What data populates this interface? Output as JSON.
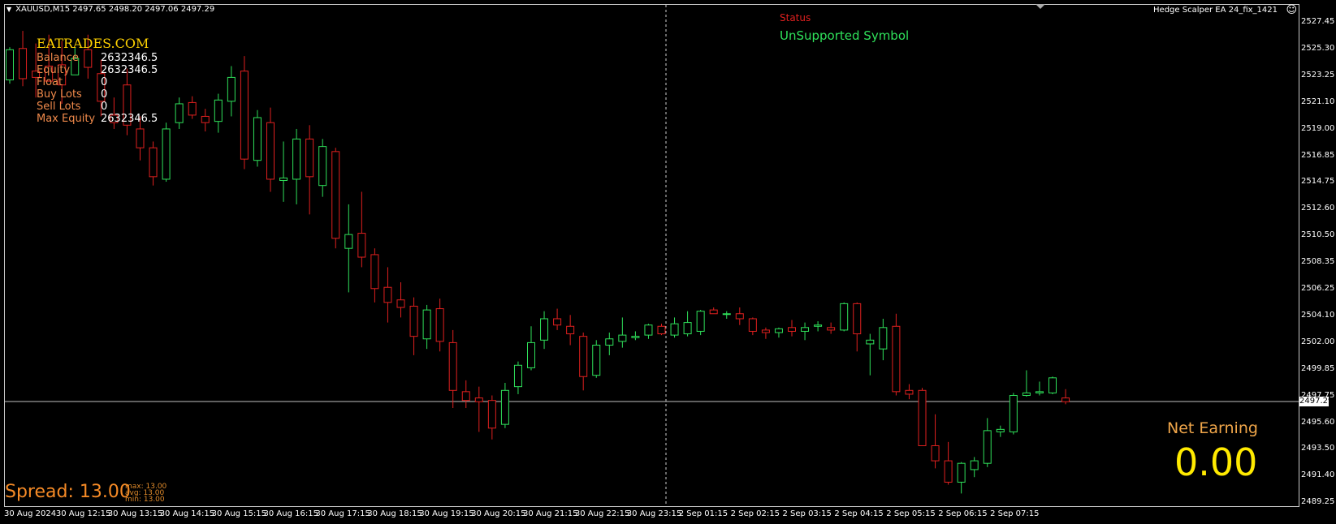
{
  "header": {
    "symbol_line": "XAUUSD,M15  2497.65 2498.20 2497.06 2497.29",
    "ea_name": "Hedge Scalper EA 24_fix_1421",
    "ea_face": "☺"
  },
  "info_panel": {
    "brand": "EATRADES.COM",
    "rows": [
      {
        "label": "Balance",
        "value": "2632346.5"
      },
      {
        "label": "Equity",
        "value": "2632346.5"
      },
      {
        "label": "Float",
        "value": "0"
      },
      {
        "label": "Buy Lots",
        "value": "0"
      },
      {
        "label": "Sell Lots",
        "value": "0"
      },
      {
        "label": "Max Equity",
        "value": "2632346.5"
      }
    ]
  },
  "status": {
    "label": "Status",
    "value": "UnSupported Symbol"
  },
  "net_earning": {
    "label": "Net Earning",
    "value": "0.00"
  },
  "spread": {
    "text": "Spread: 13.00",
    "max": "max: 13.00",
    "avg": "avg: 13.00",
    "min": "min: 13.00"
  },
  "current_price": "2497.29",
  "colors": {
    "bull": "#2fe05a",
    "bear": "#e0201f",
    "background": "#000000"
  },
  "chart_data": {
    "type": "candlestick",
    "y_ticks": [
      "2527.45",
      "2525.30",
      "2523.25",
      "2521.10",
      "2519.00",
      "2516.85",
      "2514.75",
      "2512.60",
      "2510.50",
      "2508.35",
      "2506.25",
      "2504.10",
      "2502.00",
      "2499.85",
      "2497.75",
      "2495.60",
      "2493.50",
      "2491.40",
      "2489.25"
    ],
    "x_ticks": [
      "30 Aug 2024",
      "30 Aug 12:15",
      "30 Aug 13:15",
      "30 Aug 14:15",
      "30 Aug 15:15",
      "30 Aug 16:15",
      "30 Aug 17:15",
      "30 Aug 18:15",
      "30 Aug 19:15",
      "30 Aug 20:15",
      "30 Aug 21:15",
      "30 Aug 22:15",
      "30 Aug 23:15",
      "2 Sep 01:15",
      "2 Sep 02:15",
      "2 Sep 03:15",
      "2 Sep 04:15",
      "2 Sep 05:15",
      "2 Sep 06:15",
      "2 Sep 07:15"
    ],
    "ohlc": [
      [
        2522.9,
        2525.5,
        2522.6,
        2525.3
      ],
      [
        2525.4,
        2526.8,
        2522.4,
        2523.0
      ],
      [
        2523.6,
        2525.8,
        2521.5,
        2523.1
      ],
      [
        2524.0,
        2526.5,
        2523.0,
        2522.8
      ],
      [
        2524.1,
        2526.0,
        2521.0,
        2522.5
      ],
      [
        2523.3,
        2525.5,
        2524.0,
        2524.6
      ],
      [
        2525.3,
        2526.5,
        2523.0,
        2523.9
      ],
      [
        2523.4,
        2524.5,
        2520.0,
        2521.2
      ],
      [
        2520.1,
        2521.5,
        2519.0,
        2519.5
      ],
      [
        2522.5,
        2523.8,
        2518.5,
        2519.3
      ],
      [
        2519.0,
        2520.0,
        2516.5,
        2517.5
      ],
      [
        2517.5,
        2518.0,
        2514.5,
        2515.2
      ],
      [
        2515.0,
        2519.5,
        2514.8,
        2519.0
      ],
      [
        2519.5,
        2521.5,
        2519.0,
        2521.0
      ],
      [
        2521.1,
        2521.6,
        2519.8,
        2520.1
      ],
      [
        2520.0,
        2520.6,
        2518.8,
        2519.5
      ],
      [
        2519.6,
        2521.8,
        2518.7,
        2521.3
      ],
      [
        2521.2,
        2524.0,
        2520.0,
        2523.1
      ],
      [
        2523.6,
        2524.8,
        2515.8,
        2516.6
      ],
      [
        2516.5,
        2520.5,
        2516.0,
        2519.9
      ],
      [
        2519.5,
        2520.7,
        2514.0,
        2515.0
      ],
      [
        2514.9,
        2518.0,
        2513.2,
        2515.1
      ],
      [
        2515.0,
        2519.0,
        2513.0,
        2518.2
      ],
      [
        2518.2,
        2519.3,
        2512.2,
        2515.2
      ],
      [
        2514.5,
        2518.2,
        2513.6,
        2517.6
      ],
      [
        2517.2,
        2517.5,
        2509.5,
        2510.3
      ],
      [
        2509.5,
        2513.0,
        2506.0,
        2510.6
      ],
      [
        2510.7,
        2514.0,
        2508.0,
        2508.8
      ],
      [
        2509.0,
        2509.5,
        2505.2,
        2506.3
      ],
      [
        2506.4,
        2508.0,
        2503.6,
        2505.2
      ],
      [
        2505.4,
        2506.8,
        2504.0,
        2504.8
      ],
      [
        2504.9,
        2505.6,
        2501.0,
        2502.5
      ],
      [
        2502.3,
        2505.0,
        2501.5,
        2504.6
      ],
      [
        2504.7,
        2505.5,
        2501.3,
        2502.1
      ],
      [
        2502.0,
        2503.0,
        2496.8,
        2498.2
      ],
      [
        2498.1,
        2499.0,
        2496.8,
        2497.4
      ],
      [
        2497.6,
        2498.5,
        2494.9,
        2497.3
      ],
      [
        2497.4,
        2497.8,
        2494.3,
        2495.2
      ],
      [
        2495.5,
        2498.8,
        2495.2,
        2498.2
      ],
      [
        2498.5,
        2500.5,
        2497.9,
        2500.2
      ],
      [
        2500.0,
        2503.3,
        2499.8,
        2502.0
      ],
      [
        2502.2,
        2504.5,
        2501.5,
        2503.9
      ],
      [
        2503.9,
        2504.7,
        2503.0,
        2503.4
      ],
      [
        2503.3,
        2504.2,
        2501.8,
        2502.7
      ],
      [
        2502.5,
        2502.8,
        2498.2,
        2499.3
      ],
      [
        2499.4,
        2502.2,
        2499.2,
        2501.8
      ],
      [
        2501.8,
        2502.8,
        2501.0,
        2502.3
      ],
      [
        2502.1,
        2504.0,
        2501.6,
        2502.6
      ],
      [
        2502.4,
        2502.9,
        2502.2,
        2502.5
      ],
      [
        2502.6,
        2503.5,
        2502.3,
        2503.4
      ],
      [
        2503.3,
        2503.5,
        2502.6,
        2502.7
      ],
      [
        2502.6,
        2504.0,
        2502.4,
        2503.5
      ],
      [
        2502.7,
        2504.5,
        2502.5,
        2503.6
      ],
      [
        2502.9,
        2504.6,
        2502.6,
        2504.5
      ],
      [
        2504.6,
        2504.8,
        2504.3,
        2504.3
      ],
      [
        2504.3,
        2504.5,
        2503.9,
        2504.3
      ],
      [
        2504.3,
        2504.8,
        2503.4,
        2503.9
      ],
      [
        2503.9,
        2504.0,
        2502.6,
        2502.9
      ],
      [
        2503.0,
        2503.2,
        2502.3,
        2502.8
      ],
      [
        2502.8,
        2503.2,
        2502.4,
        2503.1
      ],
      [
        2503.2,
        2503.8,
        2502.5,
        2502.9
      ],
      [
        2502.9,
        2503.6,
        2502.2,
        2503.2
      ],
      [
        2503.3,
        2503.7,
        2502.9,
        2503.4
      ],
      [
        2503.2,
        2503.6,
        2502.7,
        2503.0
      ],
      [
        2503.0,
        2505.2,
        2502.9,
        2505.1
      ],
      [
        2505.1,
        2505.2,
        2501.3,
        2502.7
      ],
      [
        2501.9,
        2502.7,
        2499.4,
        2502.2
      ],
      [
        2501.5,
        2503.9,
        2500.6,
        2503.2
      ],
      [
        2503.3,
        2504.3,
        2497.8,
        2498.1
      ],
      [
        2498.2,
        2498.7,
        2497.5,
        2497.9
      ],
      [
        2498.2,
        2498.4,
        2496.2,
        2493.8
      ],
      [
        2493.8,
        2496.3,
        2492.0,
        2492.6
      ],
      [
        2492.6,
        2494.1,
        2490.7,
        2490.9
      ],
      [
        2490.9,
        2492.5,
        2490.0,
        2492.4
      ],
      [
        2491.9,
        2492.9,
        2491.3,
        2492.6
      ],
      [
        2492.4,
        2496.0,
        2492.1,
        2495.0
      ],
      [
        2494.9,
        2495.4,
        2494.5,
        2495.1
      ],
      [
        2494.9,
        2498.0,
        2494.7,
        2497.8
      ],
      [
        2497.8,
        2499.8,
        2497.7,
        2498.0
      ],
      [
        2498.0,
        2498.9,
        2497.8,
        2498.1
      ],
      [
        2498.0,
        2499.3,
        2497.9,
        2499.2
      ],
      [
        2497.6,
        2498.3,
        2497.1,
        2497.3
      ]
    ]
  }
}
